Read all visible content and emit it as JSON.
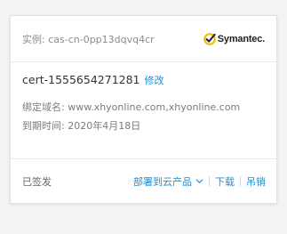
{
  "header": {
    "instance_label": "实例:",
    "instance_id": "cas-cn-0pp13dqvq4c​r",
    "brand_name": "Symantec."
  },
  "body": {
    "cert_name": "cert-1555654271281",
    "edit_label": "修改",
    "domain_label": "绑定域名:",
    "domain_value": "www.xhyonline.com,xhyonline.com",
    "expire_label": "到期时间:",
    "expire_value": "2020年4月18日"
  },
  "footer": {
    "status": "已签发",
    "deploy_label": "部署到云产品",
    "download_label": "下载",
    "revoke_label": "吊销"
  },
  "colors": {
    "link": "#1a8fd8",
    "brand_check": "#f2b705"
  },
  "icons": {
    "brand": "symantec-check-icon",
    "deploy_dropdown": "chevron-down-icon"
  }
}
